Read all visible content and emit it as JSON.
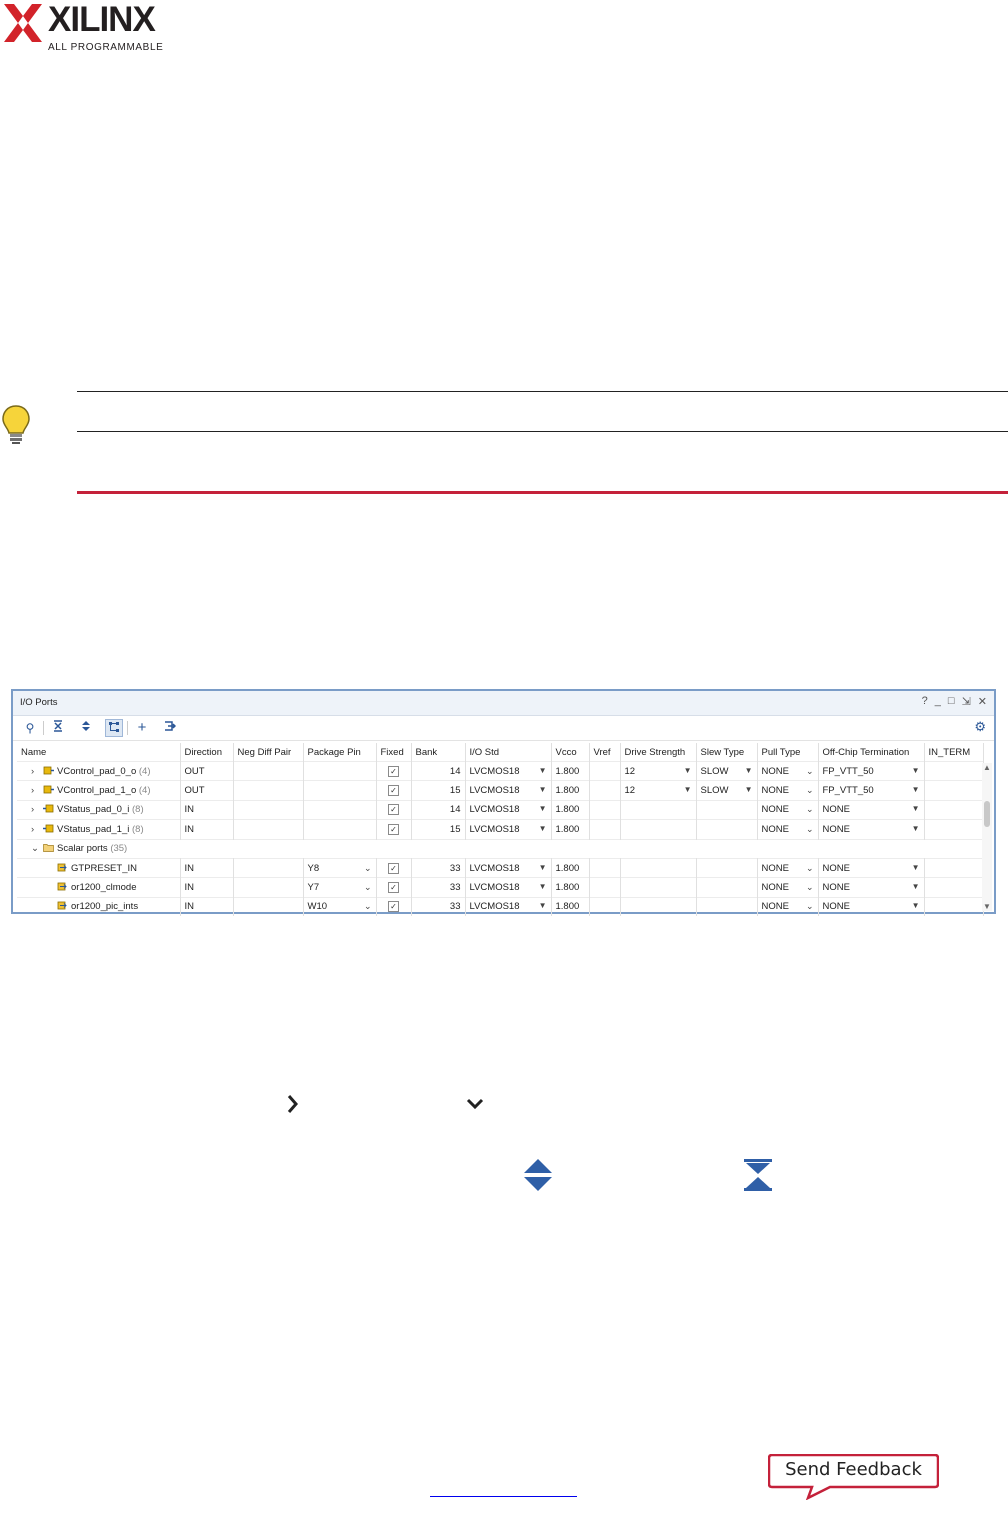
{
  "logo": {
    "wordmark": "XILINX",
    "tagline": "ALL PROGRAMMABLE"
  },
  "io_ports": {
    "title": "I/O Ports",
    "window_controls": [
      "?",
      "_",
      "□",
      "⇲",
      "✕"
    ],
    "columns": [
      "Name",
      "Direction",
      "Neg Diff Pair",
      "Package Pin",
      "Fixed",
      "Bank",
      "I/O Std",
      "Vcco",
      "Vref",
      "Drive Strength",
      "Slew Type",
      "Pull Type",
      "Off-Chip Termination",
      "IN_TERM"
    ],
    "rows": [
      {
        "expand": "›",
        "icon": "bus-out",
        "indent": 1,
        "name": "VControl_pad_0_o",
        "count": "(4)",
        "direction": "OUT",
        "neg_diff_pair": "",
        "package_pin": "",
        "fixed": true,
        "bank": "14",
        "io_std": "LVCMOS18",
        "vcco": "1.800",
        "vref": "",
        "drive_strength": "12",
        "slew_type": "SLOW",
        "pull_type": "NONE",
        "off_chip_termination": "FP_VTT_50",
        "in_term": ""
      },
      {
        "expand": "›",
        "icon": "bus-out",
        "indent": 1,
        "name": "VControl_pad_1_o",
        "count": "(4)",
        "direction": "OUT",
        "neg_diff_pair": "",
        "package_pin": "",
        "fixed": true,
        "bank": "15",
        "io_std": "LVCMOS18",
        "vcco": "1.800",
        "vref": "",
        "drive_strength": "12",
        "slew_type": "SLOW",
        "pull_type": "NONE",
        "off_chip_termination": "FP_VTT_50",
        "in_term": ""
      },
      {
        "expand": "›",
        "icon": "bus-in",
        "indent": 1,
        "name": "VStatus_pad_0_i",
        "count": "(8)",
        "direction": "IN",
        "neg_diff_pair": "",
        "package_pin": "",
        "fixed": true,
        "bank": "14",
        "io_std": "LVCMOS18",
        "vcco": "1.800",
        "vref": "",
        "drive_strength": "",
        "slew_type": "",
        "pull_type": "NONE",
        "off_chip_termination": "NONE",
        "in_term": ""
      },
      {
        "expand": "›",
        "icon": "bus-in",
        "indent": 1,
        "name": "VStatus_pad_1_i",
        "count": "(8)",
        "direction": "IN",
        "neg_diff_pair": "",
        "package_pin": "",
        "fixed": true,
        "bank": "15",
        "io_std": "LVCMOS18",
        "vcco": "1.800",
        "vref": "",
        "drive_strength": "",
        "slew_type": "",
        "pull_type": "NONE",
        "off_chip_termination": "NONE",
        "in_term": ""
      },
      {
        "group": true,
        "expand": "⌄",
        "icon": "folder",
        "name": "Scalar ports",
        "count": "(35)"
      },
      {
        "expand": "",
        "icon": "port-in",
        "indent": 2,
        "name": "GTPRESET_IN",
        "count": "",
        "direction": "IN",
        "neg_diff_pair": "",
        "package_pin": "Y8",
        "fixed": true,
        "bank": "33",
        "io_std": "LVCMOS18",
        "vcco": "1.800",
        "vref": "",
        "drive_strength": "",
        "slew_type": "",
        "pull_type": "NONE",
        "off_chip_termination": "NONE",
        "in_term": ""
      },
      {
        "expand": "",
        "icon": "port-in",
        "indent": 2,
        "name": "or1200_clmode",
        "count": "",
        "direction": "IN",
        "neg_diff_pair": "",
        "package_pin": "Y7",
        "fixed": true,
        "bank": "33",
        "io_std": "LVCMOS18",
        "vcco": "1.800",
        "vref": "",
        "drive_strength": "",
        "slew_type": "",
        "pull_type": "NONE",
        "off_chip_termination": "NONE",
        "in_term": ""
      },
      {
        "expand": "",
        "icon": "port-in",
        "indent": 2,
        "name": "or1200_pic_ints",
        "count": "",
        "direction": "IN",
        "neg_diff_pair": "",
        "package_pin": "W10",
        "fixed": true,
        "bank": "33",
        "io_std": "LVCMOS18",
        "vcco": "1.800",
        "vref": "",
        "drive_strength": "",
        "slew_type": "",
        "pull_type": "NONE",
        "off_chip_termination": "NONE",
        "in_term": ""
      }
    ]
  },
  "feedback": {
    "label": "Send Feedback"
  },
  "colors": {
    "accent_rule": "#c4213a",
    "window_border": "#7a9cc7",
    "icon_blue": "#2b5797"
  }
}
